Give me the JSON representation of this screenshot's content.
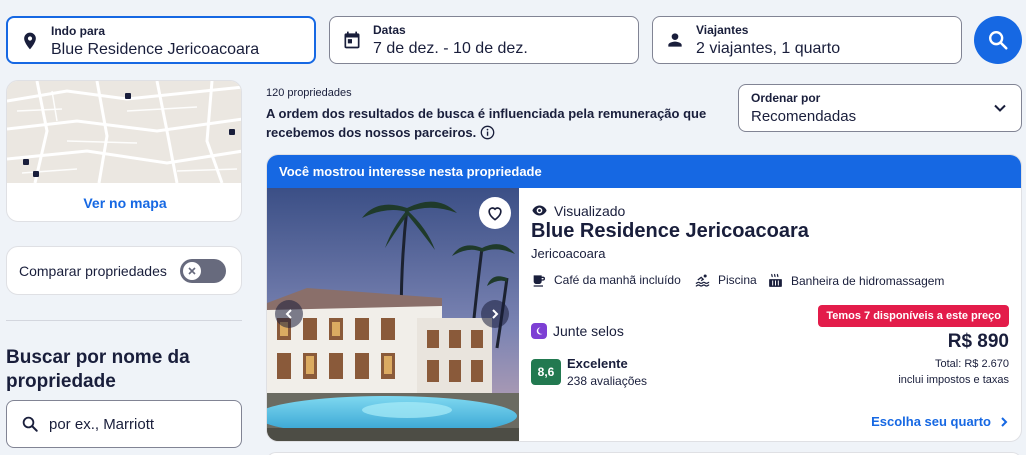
{
  "search": {
    "destination": {
      "label": "Indo para",
      "value": "Blue Residence Jericoacoara"
    },
    "dates": {
      "label": "Datas",
      "value": "7 de dez. - 10 de dez."
    },
    "travelers": {
      "label": "Viajantes",
      "value": "2 viajantes, 1 quarto"
    }
  },
  "sidebar": {
    "map_link": "Ver no mapa",
    "compare_label": "Comparar propriedades",
    "name_search_heading": "Buscar por nome da propriedade",
    "name_search_placeholder": "por ex., Marriott"
  },
  "results": {
    "count": "120 propriedades",
    "disclaimer": "A ordem dos resultados de busca é influenciada pela remuneração que recebemos dos nossos parceiros.",
    "sort_label": "Ordenar por",
    "sort_value": "Recomendadas"
  },
  "property": {
    "banner": "Você mostrou interesse nesta propriedade",
    "viewed": "Visualizado",
    "name": "Blue Residence Jericoacoara",
    "location": "Jericoacoara",
    "amenities": [
      "Café da manhã incluído",
      "Piscina",
      "Banheira de hidromassagem"
    ],
    "loyalty": "Junte selos",
    "score": "8,6",
    "rating_word": "Excelente",
    "review_count": "238 avaliações",
    "availability_badge": "Temos 7 disponíveis a este preço",
    "price": "R$ 890",
    "total": "Total: R$ 2.670",
    "taxes_note": "inclui impostos e taxas",
    "cta": "Escolha seu quarto"
  },
  "colors": {
    "brand": "#1668e3",
    "urgent": "#e31c4a",
    "score": "#227950",
    "loyalty": "#7d3fd4"
  }
}
